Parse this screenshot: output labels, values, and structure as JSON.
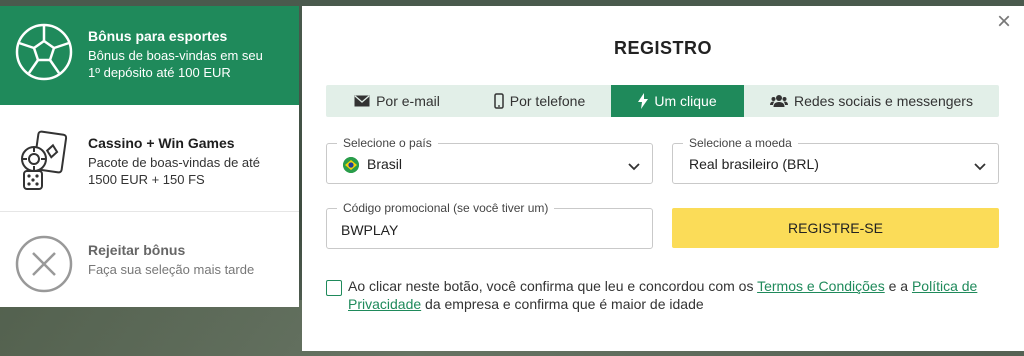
{
  "bonuses": [
    {
      "title": "Bônus para esportes",
      "description_line1": "Bônus de boas-vindas em seu",
      "description_line2": "1º depósito até 100 EUR",
      "icon": "soccer-ball-icon",
      "selected": true
    },
    {
      "title": "Cassino + Win Games",
      "description_line1": "Pacote de boas-vindas de até",
      "description_line2": "1500 EUR + 150 FS",
      "icon": "casino-cards-dice-icon",
      "selected": false
    },
    {
      "title": "Rejeitar bônus",
      "description_line1": "Faça sua seleção mais tarde",
      "icon": "reject-x-icon",
      "selected": false
    }
  ],
  "modal": {
    "close_glyph": "×",
    "title": "REGISTRO",
    "tabs": [
      {
        "label": "Por e-mail",
        "icon": "envelope-icon",
        "active": false
      },
      {
        "label": "Por telefone",
        "icon": "phone-icon",
        "active": false
      },
      {
        "label": "Um clique",
        "icon": "lightning-icon",
        "active": true
      },
      {
        "label": "Redes sociais e messengers",
        "icon": "users-icon",
        "active": false
      }
    ],
    "country": {
      "label": "Selecione o país",
      "value": "Brasil",
      "icon": "brazil-flag-icon"
    },
    "currency": {
      "label": "Selecione a moeda",
      "value": "Real brasileiro (BRL)"
    },
    "promo": {
      "label": "Código promocional (se você tiver um)",
      "value": "BWPLAY"
    },
    "register_button": "REGISTRE-SE",
    "consent": {
      "text_before": "Ao clicar neste botão, você confirma que leu e concordou com os ",
      "terms_link": "Termos e Condições",
      "text_middle": " e a ",
      "privacy_link": "Política de Privacidade",
      "text_after": " da empresa e confirma que é maior de idade",
      "checked": false
    }
  },
  "colors": {
    "brand_green": "#1f8a5b",
    "tab_bg": "#e2efe8",
    "register_yellow": "#fbdc58"
  }
}
